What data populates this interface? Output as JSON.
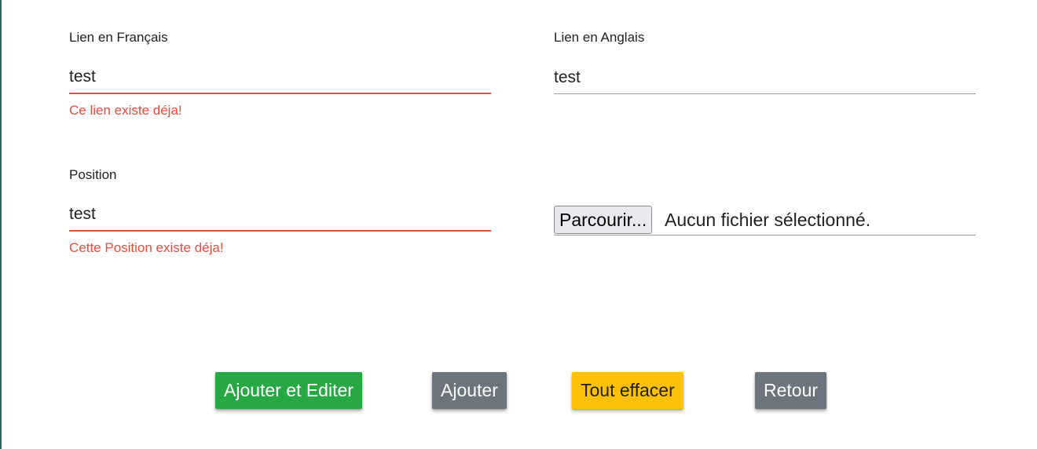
{
  "form": {
    "link_fr": {
      "label": "Lien en Français",
      "value": "test",
      "error": "Ce lien existe déja!"
    },
    "link_en": {
      "label": "Lien en Anglais",
      "value": "test"
    },
    "position": {
      "label": "Position",
      "value": "test",
      "error": "Cette Position existe déja!"
    },
    "file": {
      "button_label": "Parcourir...",
      "status": "Aucun fichier sélectionné."
    }
  },
  "actions": {
    "add_and_edit": "Ajouter et Editer",
    "add": "Ajouter",
    "clear_all": "Tout effacer",
    "back": "Retour"
  },
  "colors": {
    "error": "#e74c3c",
    "success": "#28a745",
    "secondary": "#6c757d",
    "warning": "#ffc107"
  }
}
